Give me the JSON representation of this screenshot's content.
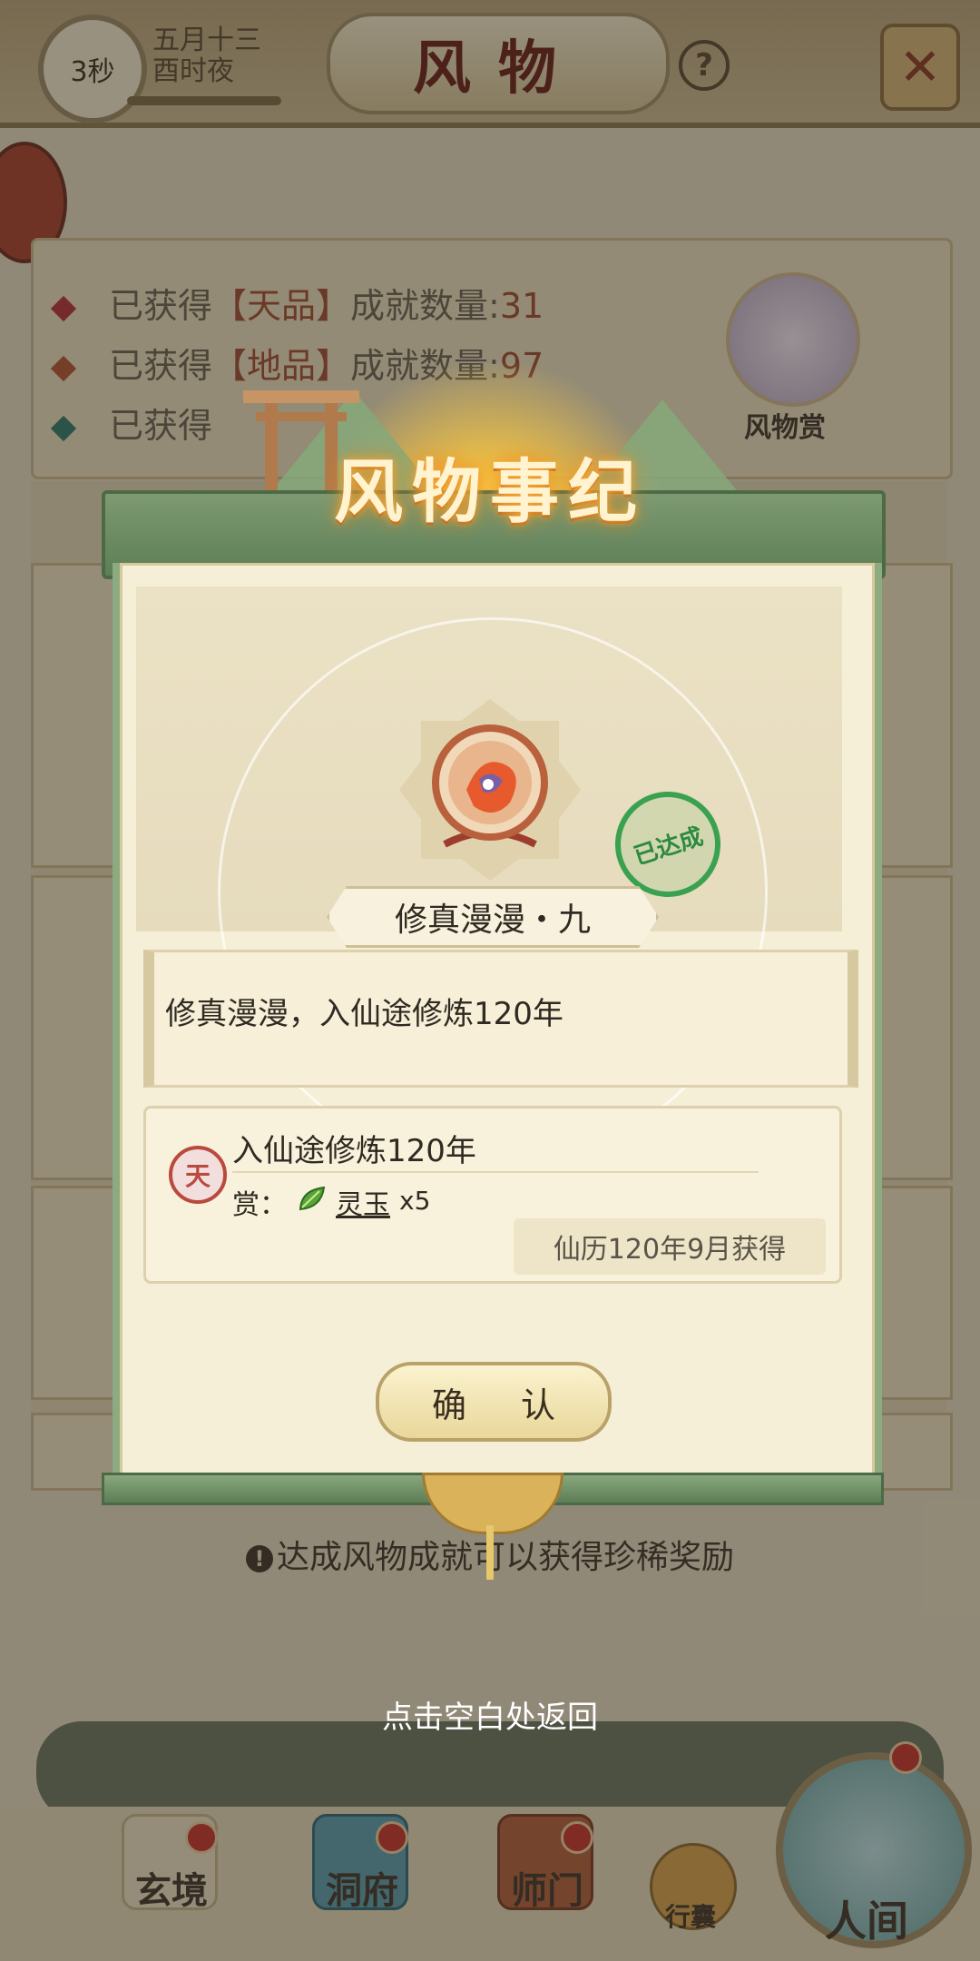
{
  "topbar": {
    "timer": "3秒",
    "date_line1": "五月十三",
    "date_line2": "酉时夜",
    "title": "风物",
    "help_symbol": "?",
    "close_symbol": "✕"
  },
  "stats": {
    "prefix": "已获得",
    "items": [
      {
        "grade": "【天品】",
        "label": "成就数量:",
        "value": "31",
        "dot_color": "#b8313a"
      },
      {
        "grade": "【地品】",
        "label": "成就数量:",
        "value": "97",
        "dot_color": "#b5552e"
      },
      {
        "grade": "",
        "label": "",
        "value": "",
        "dot_color": "#2f7a6a"
      }
    ],
    "avatar_label": "风物赏"
  },
  "modal": {
    "title": "风物事纪",
    "achievement_name": "修真漫漫・九",
    "status_stamp": "已达成",
    "description": "修真漫漫，入仙途修炼120年",
    "grade_badge": "天",
    "condition": "入仙途修炼120年",
    "reward_label": "赏：",
    "reward_item": "灵玉",
    "reward_qty": "x5",
    "obtained_time": "仙历120年9月获得",
    "confirm_label": "确 认"
  },
  "bottom_note": "达成风物成就可以获得珍稀奖励",
  "back_hint": "点击空白处返回",
  "nav": {
    "items": [
      {
        "label": "玄境"
      },
      {
        "label": "洞府"
      },
      {
        "label": "师门"
      },
      {
        "label": "行囊"
      },
      {
        "label": "人间"
      }
    ]
  },
  "colors": {
    "accent_red": "#b84a3e",
    "stamp_green": "#39a14f",
    "header_green": "#5d7e56"
  }
}
